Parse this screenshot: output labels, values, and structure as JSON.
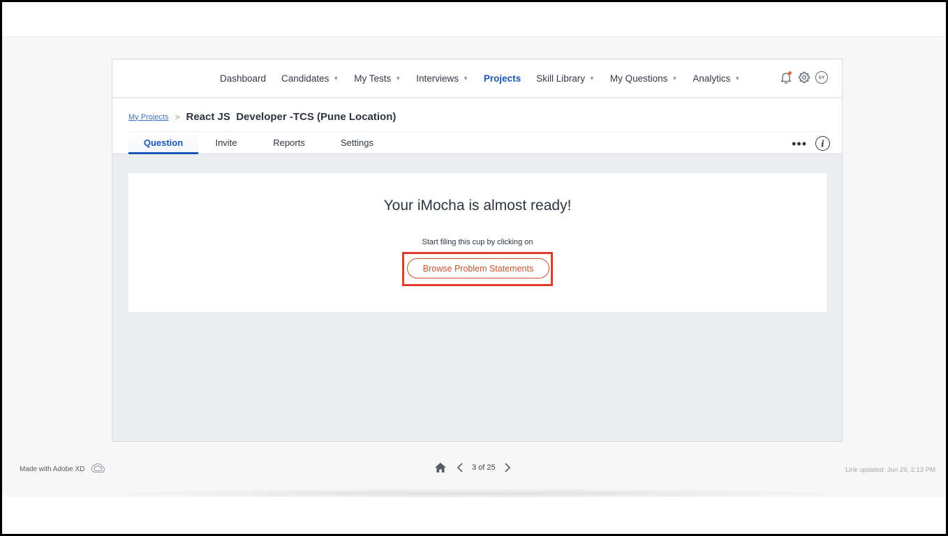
{
  "nav": {
    "items": [
      {
        "label": "Dashboard",
        "dropdown": false,
        "active": false
      },
      {
        "label": "Candidates",
        "dropdown": true,
        "active": false
      },
      {
        "label": "My Tests",
        "dropdown": true,
        "active": false
      },
      {
        "label": "Interviews",
        "dropdown": true,
        "active": false
      },
      {
        "label": "Projects",
        "dropdown": false,
        "active": true
      },
      {
        "label": "Skill Library",
        "dropdown": true,
        "active": false
      },
      {
        "label": "My Questions",
        "dropdown": true,
        "active": false
      },
      {
        "label": "Analytics",
        "dropdown": true,
        "active": false
      }
    ],
    "icons": [
      "bell-icon",
      "gear-icon",
      "avatar"
    ],
    "avatar_initials": "SY"
  },
  "breadcrumb": {
    "link": "My Projects",
    "separator": ">",
    "title": "React JS  Developer -TCS (Pune Location)"
  },
  "tabs": [
    "Question",
    "Invite",
    "Reports",
    "Settings"
  ],
  "active_tab": "Question",
  "tab_actions": {
    "more": "•••",
    "info": "i"
  },
  "card": {
    "heading": "Your iMocha is almost ready!",
    "subtext": "Start filing this cup by clicking on",
    "button": "Browse Problem Statements"
  },
  "footer": {
    "made_with": "Made with Adobe XD",
    "page_indicator": "3 of 25",
    "link_updated": "Link updated: Jun 29, 2:13 PM"
  },
  "colors": {
    "accent": "#1b55b4",
    "cta": "#c6522e",
    "highlight_box": "#e03b2c",
    "notification_dot": "#e36b2b"
  }
}
